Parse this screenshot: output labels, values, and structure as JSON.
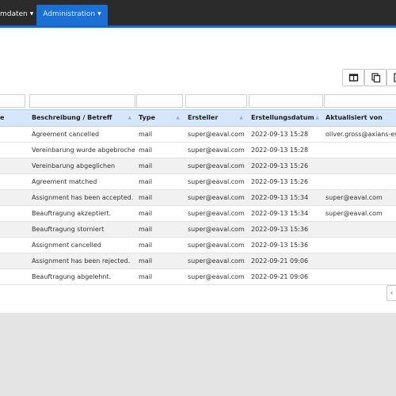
{
  "nav": {
    "stammdaten_label": "mdaten",
    "administration_label": "Administration"
  },
  "colors": {
    "topbar": "#2b2b2b",
    "accent": "#1c6fd3",
    "header_bg": "#d6e6fb"
  },
  "toolbar": {
    "icons": [
      "columns-icon",
      "copy-icon",
      "export-icon"
    ]
  },
  "table": {
    "headers": {
      "c0": "e",
      "description": "Beschreibung / Betreff",
      "type": "Type",
      "creator": "Ersteller",
      "created_at": "Erstellungsdatum",
      "updated_by": "Aktualisiert von"
    },
    "rows": [
      {
        "description": "Agreement cancelled",
        "type": "mail",
        "creator": "super@eaval.com",
        "created_at": "2022-09-13 15:28",
        "updated_by": "oliver.gross@axians-ewa"
      },
      {
        "description": "Vereinbarung wurde abgebrochen",
        "type": "mail",
        "creator": "super@eaval.com",
        "created_at": "2022-09-13 15:28",
        "updated_by": ""
      },
      {
        "description": "Vereinbarung abgeglichen",
        "type": "mail",
        "creator": "super@eaval.com",
        "created_at": "2022-09-13 15:26",
        "updated_by": ""
      },
      {
        "description": "Agreement matched",
        "type": "mail",
        "creator": "super@eaval.com",
        "created_at": "2022-09-13 15:26",
        "updated_by": ""
      },
      {
        "description": "Assignment has been accepted.",
        "type": "mail",
        "creator": "super@eaval.com",
        "created_at": "2022-09-13 15:34",
        "updated_by": "super@eaval.com"
      },
      {
        "description": "Beauftragung akzeptiert.",
        "type": "mail",
        "creator": "super@eaval.com",
        "created_at": "2022-09-13 15:34",
        "updated_by": "super@eaval.com"
      },
      {
        "description": "Beauftragung storniert",
        "type": "mail",
        "creator": "super@eaval.com",
        "created_at": "2022-09-13 15:36",
        "updated_by": ""
      },
      {
        "description": "Assignment cancelled",
        "type": "mail",
        "creator": "super@eaval.com",
        "created_at": "2022-09-13 15:36",
        "updated_by": ""
      },
      {
        "description": "Assignment has been rejected.",
        "type": "mail",
        "creator": "super@eaval.com",
        "created_at": "2022-09-21 09:06",
        "updated_by": ""
      },
      {
        "description": "Beauftragung abgelehnt.",
        "type": "mail",
        "creator": "super@eaval.com",
        "created_at": "2022-09-21 09:06",
        "updated_by": ""
      }
    ]
  },
  "pager": {
    "prev_label": "‹"
  }
}
